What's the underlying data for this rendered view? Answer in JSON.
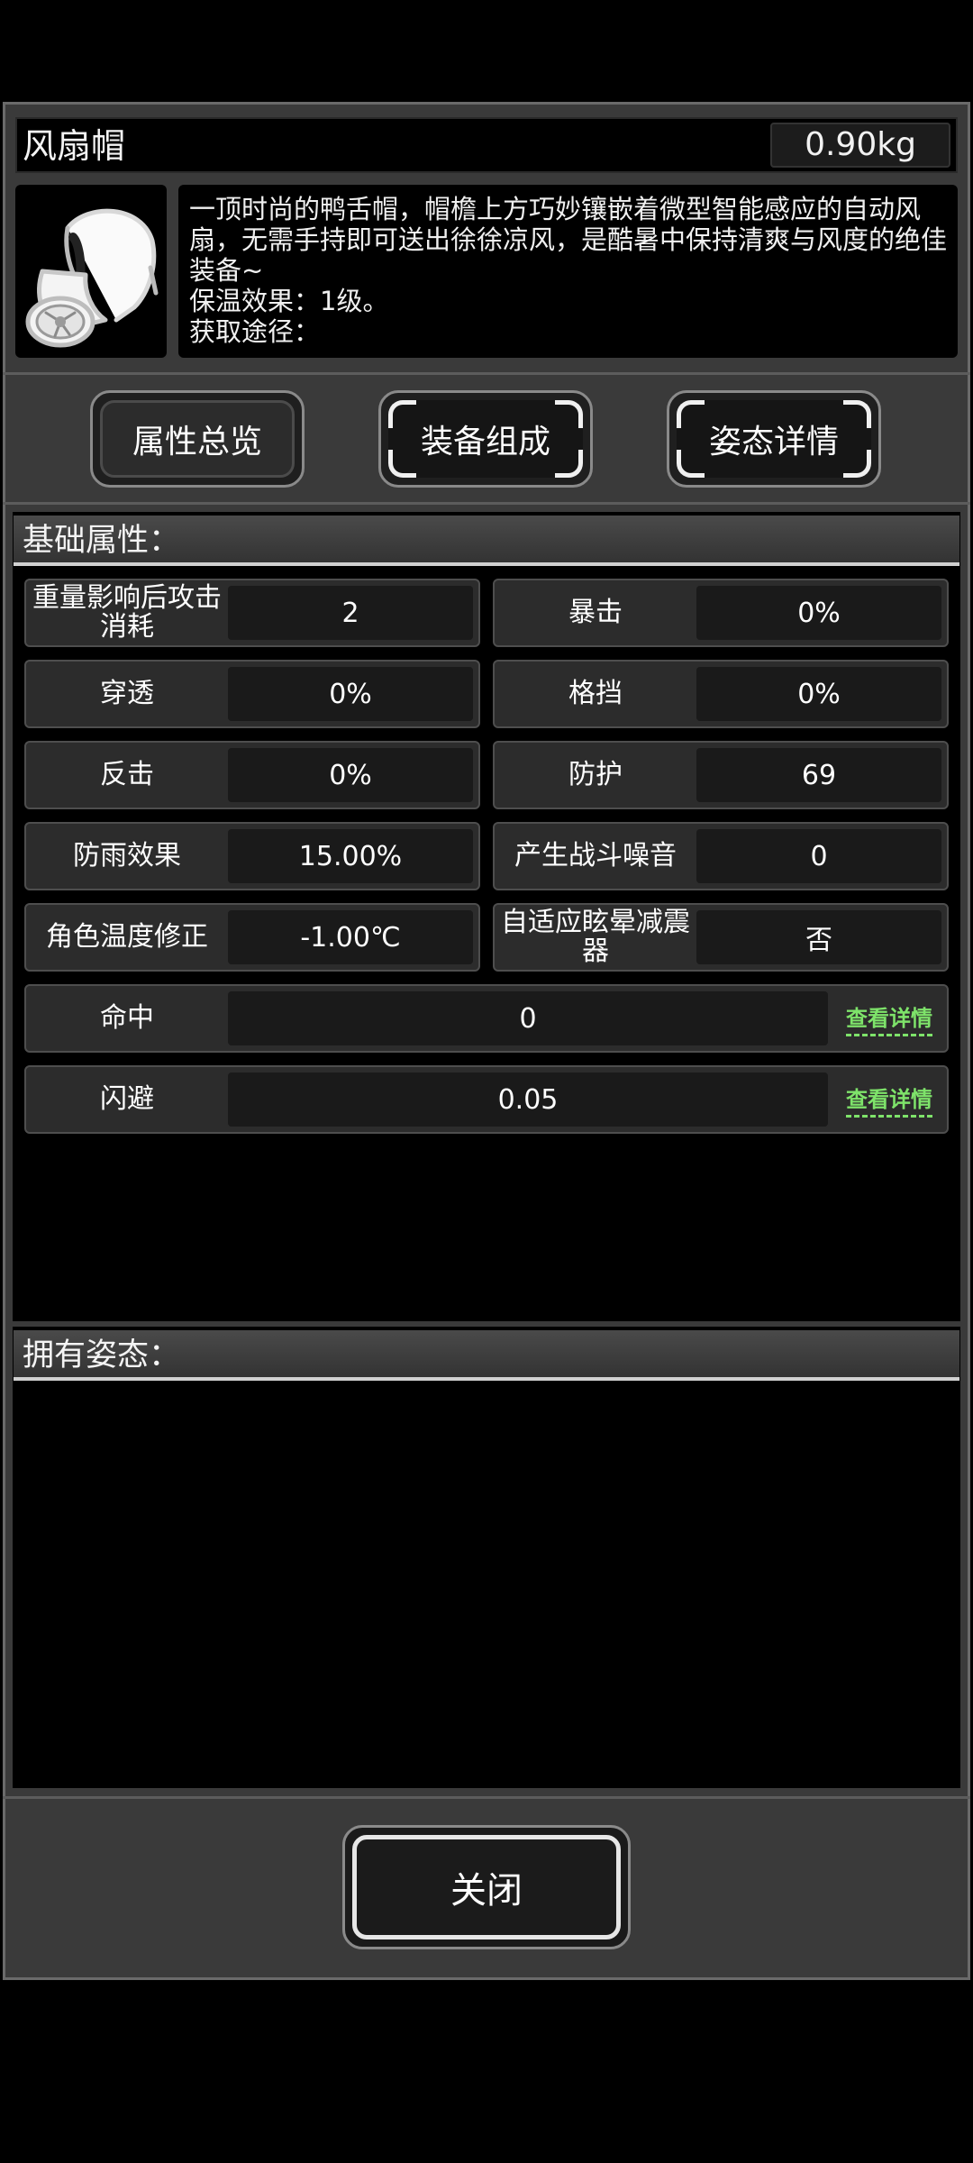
{
  "item": {
    "name": "风扇帽",
    "weight": "0.90kg",
    "image_icon": "fan-cap-icon",
    "description": "一顶时尚的鸭舌帽，帽檐上方巧妙镶嵌着微型智能感应的自动风扇，无需手持即可送出徐徐凉风，是酷暑中保持清爽与风度的绝佳装备~",
    "warmth": "保温效果：1级。",
    "source": "获取途径："
  },
  "tabs": [
    {
      "label": "属性总览",
      "selected": true
    },
    {
      "label": "装备组成",
      "selected": false
    },
    {
      "label": "姿态详情",
      "selected": false
    }
  ],
  "basic": {
    "title": "基础属性：",
    "attributes": [
      {
        "name": "重量影响后攻击消耗",
        "value": "2"
      },
      {
        "name": "暴击",
        "value": "0%"
      },
      {
        "name": "穿透",
        "value": "0%"
      },
      {
        "name": "格挡",
        "value": "0%"
      },
      {
        "name": "反击",
        "value": "0%"
      },
      {
        "name": "防护",
        "value": "69"
      },
      {
        "name": "防雨效果",
        "value": "15.00%"
      },
      {
        "name": "产生战斗噪音",
        "value": "0"
      },
      {
        "name": "角色温度修正",
        "value": "-1.00℃"
      },
      {
        "name": "自适应眩晕减震器",
        "value": "否"
      }
    ],
    "wide_attributes": [
      {
        "name": "命中",
        "value": "0",
        "detail_label": "查看详情"
      },
      {
        "name": "闪避",
        "value": "0.05",
        "detail_label": "查看详情"
      }
    ]
  },
  "stance": {
    "title": "拥有姿态："
  },
  "close_label": "关闭",
  "colors": {
    "background": "#000000",
    "panel": "#3a3a3a",
    "detail_link": "#7ee36a"
  }
}
